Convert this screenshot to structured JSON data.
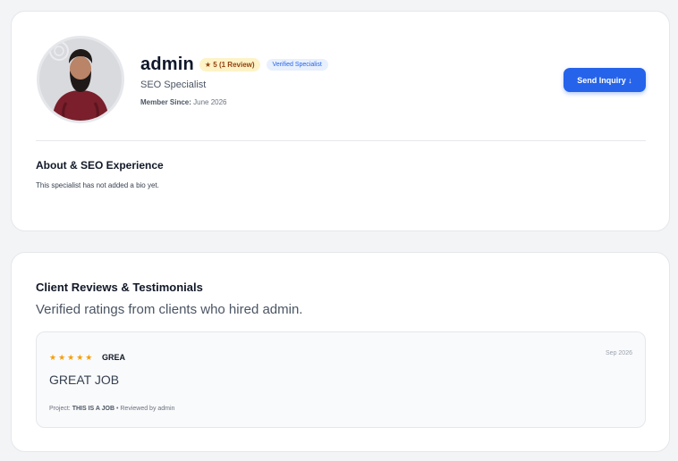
{
  "profile": {
    "name": "admin",
    "rating_badge": "★ 5 (1 Review)",
    "verified_badge": "Verified Specialist",
    "role": "SEO Specialist",
    "member_since_label": "Member Since:",
    "member_since_value": "June 2026",
    "inquiry_button": "Send Inquiry ↓",
    "about_heading": "About & SEO Experience",
    "about_text": "This specialist has not added a bio yet."
  },
  "reviews": {
    "heading": "Client Reviews & Testimonials",
    "subtitle": "Verified ratings from clients who hired admin.",
    "items": [
      {
        "stars": "★★★★★",
        "rating": 5,
        "title": "GREA",
        "date": "Sep 2026",
        "body": "GREAT JOB",
        "project_label": "Project:",
        "project_name": "THIS IS A JOB",
        "reviewed_by": "• Reviewed by admin"
      }
    ]
  },
  "colors": {
    "accent": "#2563eb",
    "star": "#f59e0b",
    "rating_badge_bg": "#fdf3c7",
    "verified_badge_bg": "#e8f0fd"
  }
}
